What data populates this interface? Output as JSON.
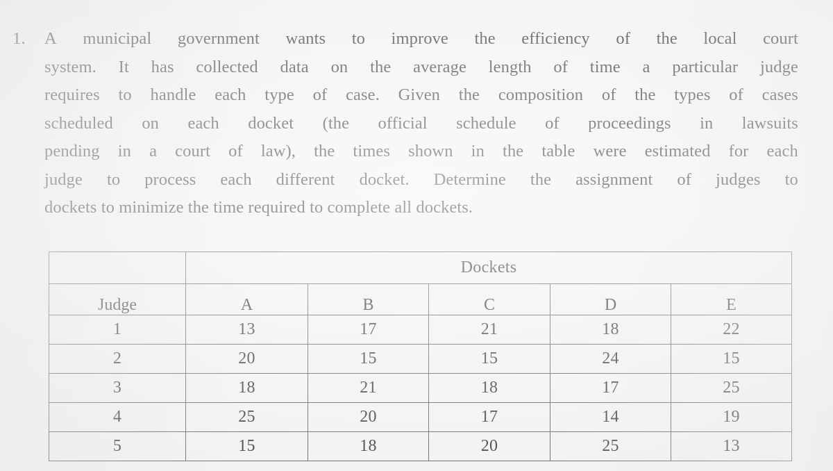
{
  "question": {
    "number": "1.",
    "lines": [
      "A municipal government wants to improve the efficiency of the local court",
      "system. It has collected data on the average length of time a particular judge",
      "requires to handle each type of case. Given the composition of the types of cases",
      "scheduled on each docket (the official schedule of proceedings in lawsuits",
      "pending in a court of law), the times shown in the table were estimated for each",
      "judge to process each different docket. Determine the assignment of judges to",
      "dockets to minimize the time required to complete all dockets."
    ],
    "full_text": "1. A municipal government wants to improve the efficiency of the local court system. It has collected data on the average length of time a particular judge requires to handle each type of case. Given the composition of the types of cases scheduled on each docket (the official schedule of proceedings in lawsuits pending in a court of law), the times shown in the table were estimated for each judge to process each different docket. Determine the assignment of judges to dockets to minimize the time required to complete all dockets."
  },
  "table": {
    "group_header": "Dockets",
    "row_header_label": "Judge",
    "columns": [
      "A",
      "B",
      "C",
      "D",
      "E"
    ],
    "rows": [
      {
        "judge": "1",
        "values": [
          "13",
          "17",
          "21",
          "18",
          "22"
        ]
      },
      {
        "judge": "2",
        "values": [
          "20",
          "15",
          "15",
          "24",
          "15"
        ]
      },
      {
        "judge": "3",
        "values": [
          "18",
          "21",
          "18",
          "17",
          "25"
        ]
      },
      {
        "judge": "4",
        "values": [
          "25",
          "20",
          "17",
          "14",
          "19"
        ]
      },
      {
        "judge": "5",
        "values": [
          "15",
          "18",
          "20",
          "25",
          "13"
        ]
      }
    ]
  },
  "chart_data": {
    "type": "table",
    "title": "Dockets",
    "xlabel": "Dockets",
    "ylabel": "Judge",
    "categories": [
      "A",
      "B",
      "C",
      "D",
      "E"
    ],
    "series": [
      {
        "name": "1",
        "values": [
          13,
          17,
          21,
          18,
          22
        ]
      },
      {
        "name": "2",
        "values": [
          20,
          15,
          15,
          24,
          15
        ]
      },
      {
        "name": "3",
        "values": [
          18,
          21,
          18,
          17,
          25
        ]
      },
      {
        "name": "4",
        "values": [
          25,
          20,
          17,
          14,
          19
        ]
      },
      {
        "name": "5",
        "values": [
          15,
          18,
          20,
          25,
          13
        ]
      }
    ]
  },
  "colors": {
    "page_background": "#f2f2f1",
    "text": "#4b4b4b",
    "table_border": "#6e6e6e"
  }
}
